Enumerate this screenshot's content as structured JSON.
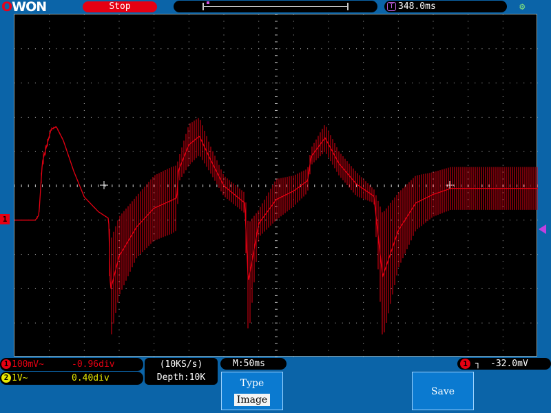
{
  "brand": {
    "logo_text": "OWON"
  },
  "header": {
    "run_state": "Stop",
    "time_position": "348.0ms",
    "trigger_marker_label": "T",
    "usb_icon": "usb-icon"
  },
  "channel_markers": {
    "ch1_ground": "1"
  },
  "status": {
    "ch1": {
      "num": "1",
      "scale": "100mV~",
      "offset": "-0.96div"
    },
    "ch2": {
      "num": "2",
      "scale": "1V~",
      "offset": "0.40div"
    },
    "sample_rate": "(10KS/s)",
    "depth": "Depth:10K",
    "timebase": "M:50ms",
    "trigger": {
      "channel": "1",
      "edge_icon": "rising-edge-icon",
      "edge_glyph": "┘┐",
      "level": "-32.0mV"
    }
  },
  "menu": {
    "type_label": "Type",
    "type_value": "Image",
    "save_label": "Save"
  },
  "colors": {
    "ch1": "#e60012",
    "ch2": "#e8e800",
    "grid": "#c0c0c0",
    "trigger": "#c040e0"
  },
  "chart_data": {
    "type": "line",
    "title": "",
    "xlabel": "",
    "ylabel": "",
    "grid": true,
    "divisions": {
      "x": 15,
      "y": 10
    },
    "xlim_div": [
      0,
      15
    ],
    "ylim_div": [
      -5,
      5
    ],
    "series": [
      {
        "name": "CH1",
        "note_units": "divisions from center",
        "envelope": [
          [
            0.0,
            -1.0,
            -1.0
          ],
          [
            0.6,
            -1.02,
            -0.98
          ],
          [
            0.7,
            -0.9,
            -0.8
          ],
          [
            0.8,
            0.5,
            0.9
          ],
          [
            1.05,
            1.6,
            1.7
          ],
          [
            1.2,
            1.7,
            1.75
          ],
          [
            1.4,
            1.3,
            1.35
          ],
          [
            1.7,
            0.4,
            0.45
          ],
          [
            2.0,
            -0.35,
            -0.3
          ],
          [
            2.4,
            -0.75,
            -0.75
          ],
          [
            2.7,
            -0.95,
            -0.95
          ],
          [
            2.75,
            -4.5,
            -1.6
          ],
          [
            3.0,
            -3.2,
            -0.9
          ],
          [
            3.5,
            -2.1,
            -0.3
          ],
          [
            4.0,
            -1.6,
            0.3
          ],
          [
            4.5,
            -1.4,
            0.55
          ],
          [
            4.65,
            -1.3,
            0.6
          ],
          [
            4.7,
            0.1,
            0.8
          ],
          [
            5.0,
            0.6,
            1.8
          ],
          [
            5.3,
            0.9,
            2.0
          ],
          [
            5.6,
            0.4,
            1.2
          ],
          [
            6.0,
            -0.3,
            0.3
          ],
          [
            6.6,
            -0.8,
            -0.2
          ],
          [
            6.7,
            -4.5,
            -1.1
          ],
          [
            7.0,
            -1.5,
            -0.7
          ],
          [
            7.5,
            -1.0,
            0.2
          ],
          [
            8.0,
            -0.6,
            0.3
          ],
          [
            8.4,
            -0.2,
            0.5
          ],
          [
            8.5,
            0.6,
            1.1
          ],
          [
            8.9,
            1.0,
            1.8
          ],
          [
            9.3,
            0.3,
            1.0
          ],
          [
            9.8,
            -0.3,
            0.4
          ],
          [
            10.3,
            -0.5,
            -0.1
          ],
          [
            10.55,
            -4.5,
            -0.8
          ],
          [
            11.0,
            -2.4,
            -0.2
          ],
          [
            11.5,
            -1.3,
            0.3
          ],
          [
            12.0,
            -0.9,
            0.4
          ],
          [
            12.5,
            -0.7,
            0.55
          ],
          [
            13.0,
            -0.7,
            0.55
          ],
          [
            13.5,
            -0.7,
            0.55
          ],
          [
            14.0,
            -0.7,
            0.55
          ],
          [
            15.0,
            -0.7,
            0.55
          ]
        ]
      }
    ]
  }
}
